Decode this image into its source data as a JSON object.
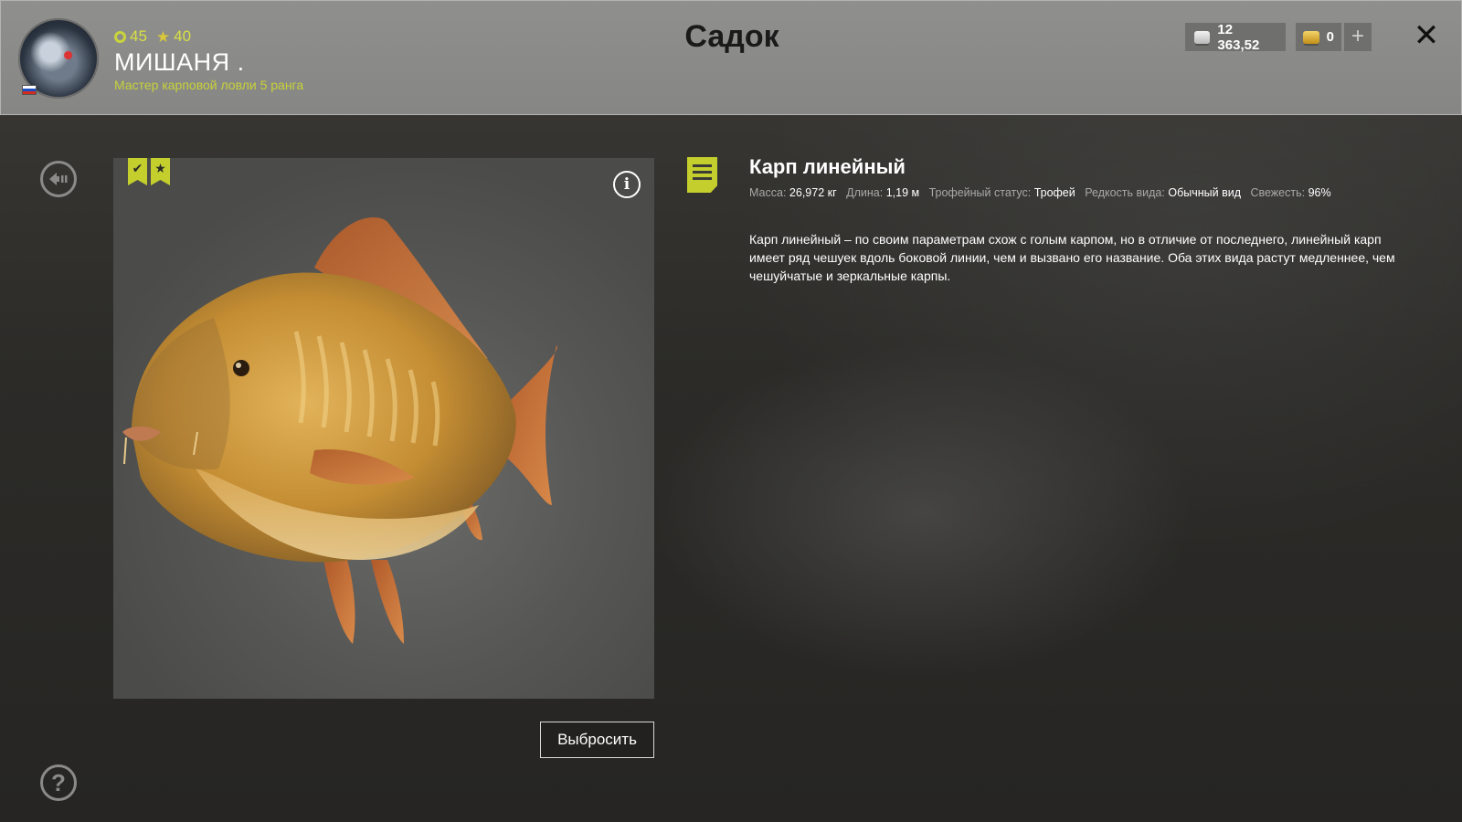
{
  "header": {
    "title": "Садок",
    "player": {
      "level": "45",
      "stars": "40",
      "name": "МИШАНЯ .",
      "rank": "Мастер карповой ловли 5 ранга"
    },
    "silver_amount": "12 363,52",
    "gold_amount": "0",
    "add_label": "+",
    "close_label": "✕"
  },
  "fish": {
    "name": "Карп линейный",
    "params": {
      "mass_label": "Масса:",
      "mass_value": "26,972 кг",
      "length_label": "Длина:",
      "length_value": "1,19 м",
      "trophy_label": "Трофейный статус:",
      "trophy_value": "Трофей",
      "rarity_label": "Редкость вида:",
      "rarity_value": "Обычный вид",
      "freshness_label": "Свежесть:",
      "freshness_value": "96%"
    },
    "description": "Карп линейный – по своим параметрам схож с голым карпом, но в отличие от последнего, линейный карп имеет ряд чешуек вдоль боковой линии, чем и вызвано его название. Оба этих вида растут медленнее, чем чешуйчатые и зеркальные карпы.",
    "badges": {
      "check": "✔",
      "star": "★"
    },
    "info_label": "i"
  },
  "actions": {
    "discard_label": "Выбросить"
  },
  "side": {
    "help_label": "?"
  },
  "colors": {
    "accent": "#c4cf2d",
    "topbar": "#8b8b89"
  },
  "icons": [
    "back-icon",
    "help-icon",
    "info-icon",
    "document-icon",
    "silver-coin-icon",
    "gold-coin-icon",
    "close-icon"
  ]
}
